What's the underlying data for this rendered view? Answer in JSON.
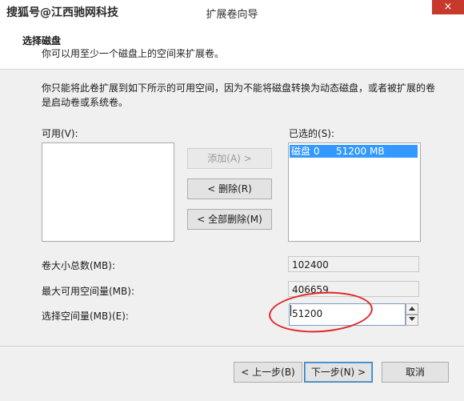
{
  "watermark": "搜狐号@江西驰网科技",
  "window": {
    "title": "扩展卷向导",
    "close_symbol": "×"
  },
  "header": {
    "title": "选择磁盘",
    "subtitle": "你可以用至少一个磁盘上的空间来扩展卷。"
  },
  "description": "你只能将此卷扩展到如下所示的可用空间，因为不能将磁盘转换为动态磁盘，或者被扩展的卷是启动卷或系统卷。",
  "available": {
    "label": "可用(V):",
    "items": []
  },
  "selected": {
    "label": "已选的(S):",
    "items": [
      {
        "disk": "磁盘 0",
        "size": "51200 MB"
      }
    ]
  },
  "buttons": {
    "add": "添加(A) >",
    "remove": "< 删除(R)",
    "remove_all": "< 全部删除(M)"
  },
  "fields": {
    "total_size": {
      "label": "卷大小总数(MB):",
      "value": "102400"
    },
    "max_available": {
      "label": "最大可用空间量(MB):",
      "value": "406659"
    },
    "select_amount": {
      "label": "选择空间量(MB)(E):",
      "value": "51200"
    }
  },
  "footer": {
    "back": "< 上一步(B)",
    "next": "下一步(N) >",
    "cancel": "取消"
  },
  "colors": {
    "selection": "#3399ff",
    "annotation": "#e0262b",
    "close": "#c7392b"
  }
}
